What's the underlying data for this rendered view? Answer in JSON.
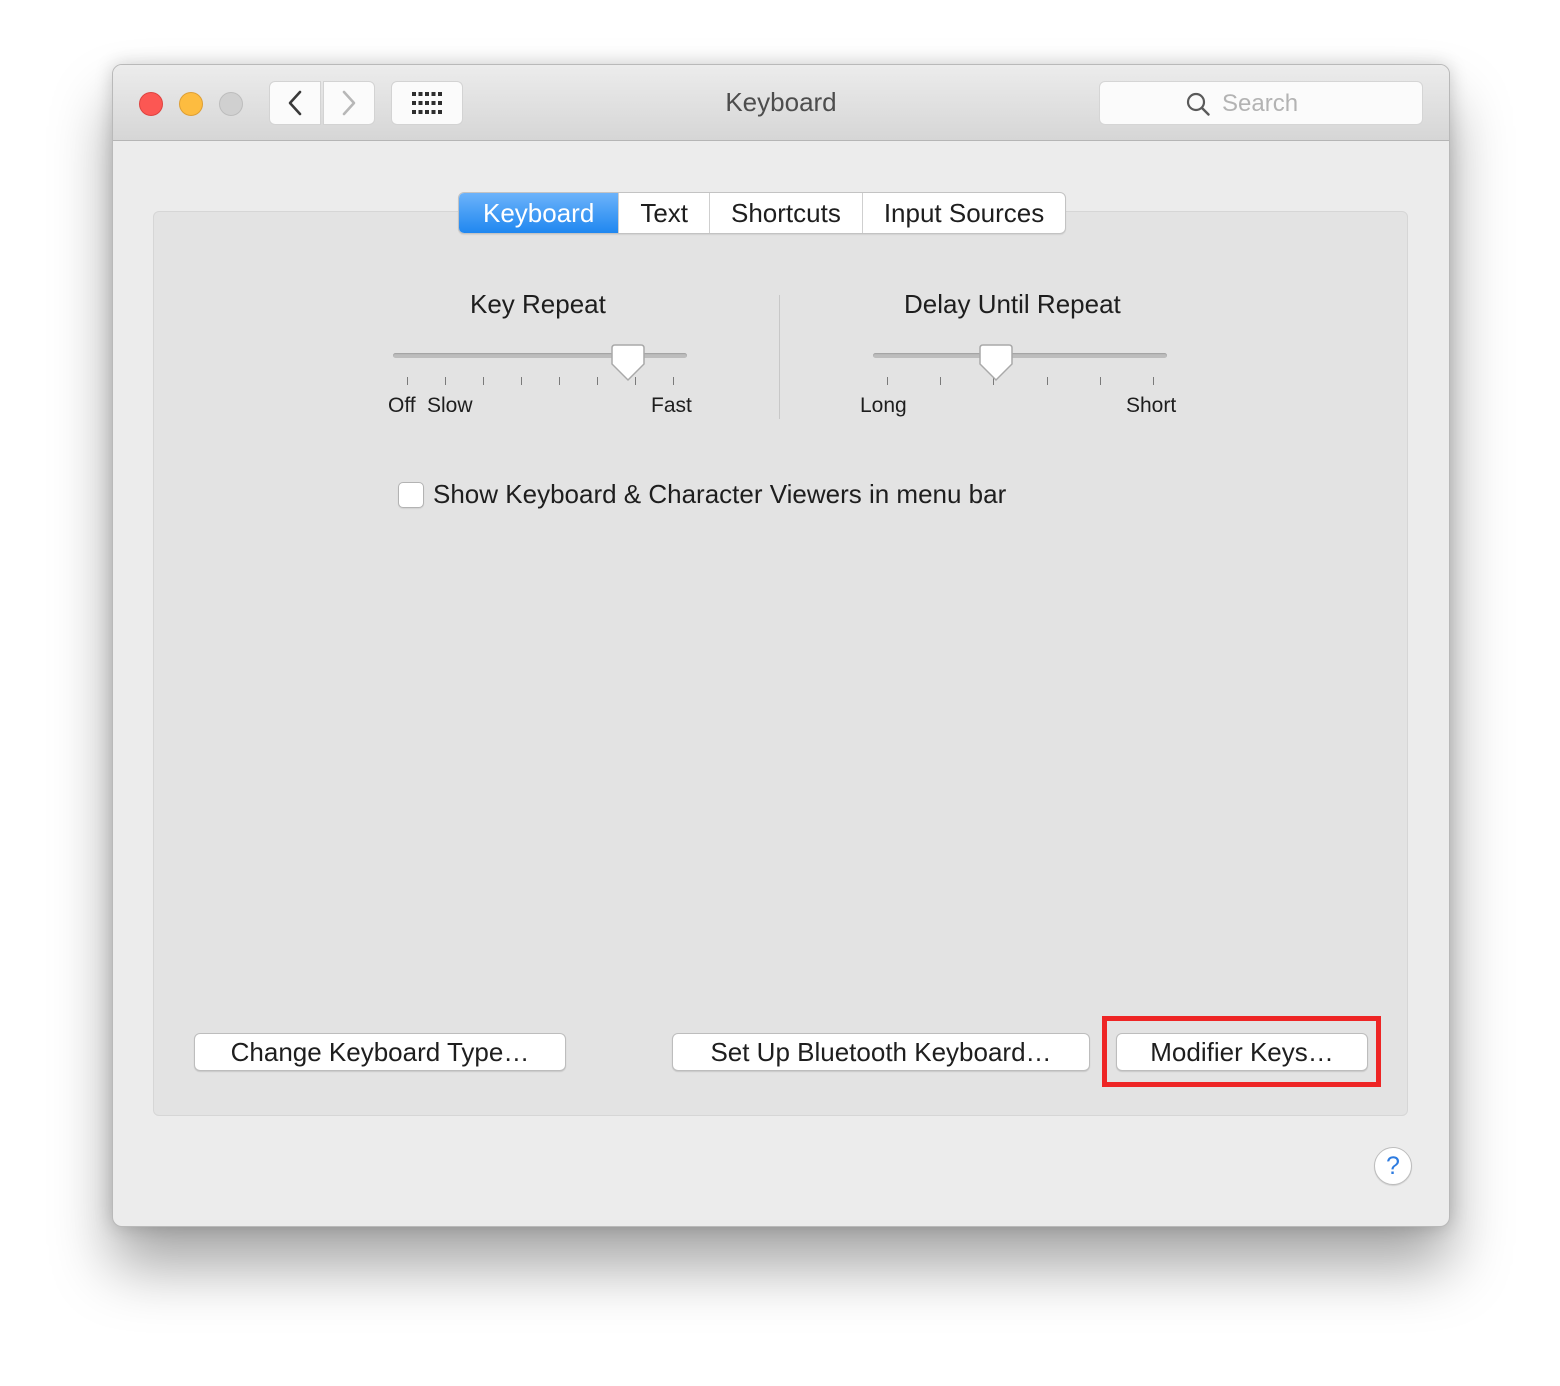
{
  "window": {
    "title": "Keyboard",
    "search_placeholder": "Search"
  },
  "tabs": [
    {
      "label": "Keyboard",
      "selected": true
    },
    {
      "label": "Text",
      "selected": false
    },
    {
      "label": "Shortcuts",
      "selected": false
    },
    {
      "label": "Input Sources",
      "selected": false
    }
  ],
  "key_repeat": {
    "title": "Key Repeat",
    "min_label": "Off",
    "slow_label": "Slow",
    "max_label": "Fast",
    "tick_count": 8,
    "value_fraction": 0.83
  },
  "delay_until_repeat": {
    "title": "Delay Until Repeat",
    "min_label": "Long",
    "max_label": "Short",
    "tick_count": 6,
    "value_fraction": 0.41
  },
  "show_viewers_checkbox": {
    "label": "Show Keyboard & Character Viewers in menu bar",
    "checked": false
  },
  "buttons": {
    "change_keyboard_type": "Change Keyboard Type…",
    "bluetooth_keyboard": "Set Up Bluetooth Keyboard…",
    "modifier_keys": "Modifier Keys…",
    "help": "?"
  },
  "colors": {
    "accent": "#1f87f0",
    "highlight_box": "#ee2525",
    "close": "#fc5753",
    "minimize": "#fdbc40"
  },
  "icons": [
    "back-chevron-icon",
    "forward-chevron-icon",
    "grid-icon",
    "magnifier-icon"
  ]
}
